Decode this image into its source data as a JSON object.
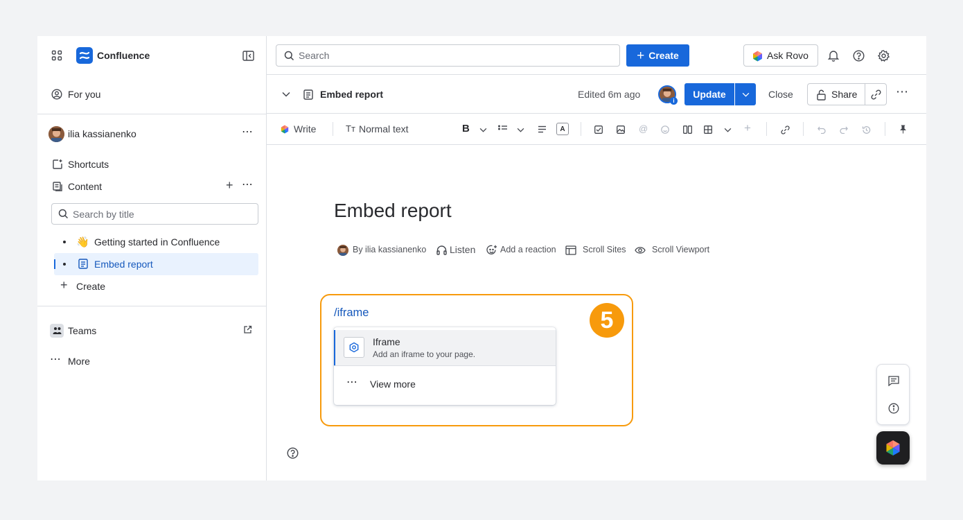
{
  "sidebar": {
    "app_name": "Confluence",
    "for_you": "For you",
    "user_name": "ilia kassianenko",
    "shortcuts": "Shortcuts",
    "content": "Content",
    "search_placeholder": "Search by title",
    "tree": [
      {
        "emoji": "👋",
        "label": "Getting started in Confluence"
      },
      {
        "label": "Embed report"
      }
    ],
    "create": "Create",
    "teams": "Teams",
    "more": "More"
  },
  "topbar": {
    "search_placeholder": "Search",
    "create_label": "Create",
    "ask_rovo": "Ask Rovo"
  },
  "page_header": {
    "title": "Embed report",
    "edited": "Edited 6m ago",
    "update": "Update",
    "close": "Close",
    "share": "Share"
  },
  "toolbar": {
    "write": "Write",
    "text_style": "Normal text"
  },
  "page": {
    "title": "Embed report",
    "byline": {
      "author": "By ilia kassianenko",
      "listen": "Listen",
      "reaction": "Add a reaction",
      "scroll_sites": "Scroll Sites",
      "scroll_viewport": "Scroll Viewport"
    },
    "slash_command": "/iframe",
    "menu": {
      "items": [
        {
          "title": "Iframe",
          "description": "Add an iframe to your page."
        }
      ],
      "view_more": "View more"
    },
    "step_number": "5"
  },
  "colors": {
    "brand": "#1868db",
    "highlight": "#f79a0c",
    "selected_bg": "#e9f2fe"
  }
}
